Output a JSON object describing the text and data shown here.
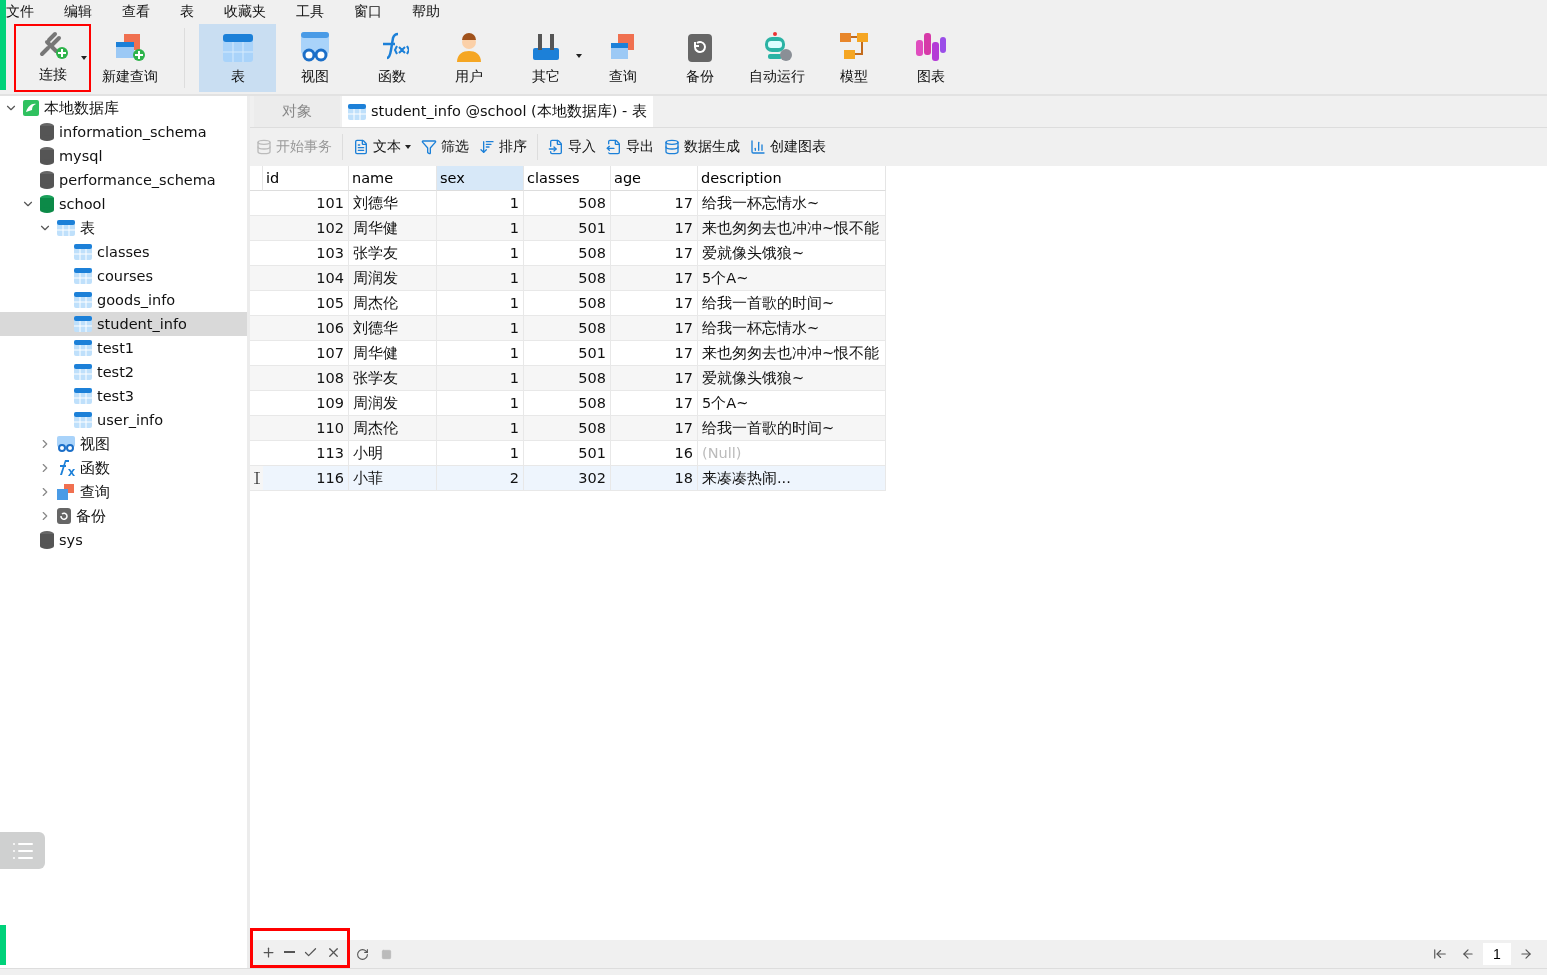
{
  "menu": [
    "文件",
    "编辑",
    "查看",
    "表",
    "收藏夹",
    "工具",
    "窗口",
    "帮助"
  ],
  "toolbar": [
    {
      "label": "连接",
      "selected": false,
      "dropdown": true,
      "highlighted": true
    },
    {
      "label": "新建查询",
      "selected": false,
      "dropdown": false,
      "highlighted": false
    },
    {
      "label": "表",
      "selected": true,
      "dropdown": false,
      "highlighted": false
    },
    {
      "label": "视图",
      "selected": false,
      "dropdown": false,
      "highlighted": false
    },
    {
      "label": "函数",
      "selected": false,
      "dropdown": false,
      "highlighted": false
    },
    {
      "label": "用户",
      "selected": false,
      "dropdown": false,
      "highlighted": false
    },
    {
      "label": "其它",
      "selected": false,
      "dropdown": true,
      "highlighted": false
    },
    {
      "label": "查询",
      "selected": false,
      "dropdown": false,
      "highlighted": false
    },
    {
      "label": "备份",
      "selected": false,
      "dropdown": false,
      "highlighted": false
    },
    {
      "label": "自动运行",
      "selected": false,
      "dropdown": false,
      "highlighted": false
    },
    {
      "label": "模型",
      "selected": false,
      "dropdown": false,
      "highlighted": false
    },
    {
      "label": "图表",
      "selected": false,
      "dropdown": false,
      "highlighted": false
    }
  ],
  "tree": [
    {
      "label": "本地数据库",
      "kind": "connection",
      "expanded": true,
      "selected": false,
      "children": [
        {
          "label": "information_schema",
          "kind": "database",
          "selected": false
        },
        {
          "label": "mysql",
          "kind": "database",
          "selected": false
        },
        {
          "label": "performance_schema",
          "kind": "database",
          "selected": false
        },
        {
          "label": "school",
          "kind": "database",
          "expanded": true,
          "selected": false,
          "children": [
            {
              "label": "表",
              "kind": "tables",
              "expanded": true,
              "selected": false,
              "children": [
                {
                  "label": "classes",
                  "kind": "table",
                  "selected": false
                },
                {
                  "label": "courses",
                  "kind": "table",
                  "selected": false
                },
                {
                  "label": "goods_info",
                  "kind": "table",
                  "selected": false
                },
                {
                  "label": "student_info",
                  "kind": "table",
                  "selected": true
                },
                {
                  "label": "test1",
                  "kind": "table",
                  "selected": false
                },
                {
                  "label": "test2",
                  "kind": "table",
                  "selected": false
                },
                {
                  "label": "test3",
                  "kind": "table",
                  "selected": false
                },
                {
                  "label": "user_info",
                  "kind": "table",
                  "selected": false
                }
              ]
            },
            {
              "label": "视图",
              "kind": "views",
              "expanded": false,
              "selected": false
            },
            {
              "label": "函数",
              "kind": "functions",
              "expanded": false,
              "selected": false
            },
            {
              "label": "查询",
              "kind": "queries",
              "expanded": false,
              "selected": false
            },
            {
              "label": "备份",
              "kind": "backups",
              "expanded": false,
              "selected": false
            }
          ]
        },
        {
          "label": "sys",
          "kind": "database",
          "selected": false
        }
      ]
    }
  ],
  "tabs": [
    {
      "label": "对象",
      "selected": false
    },
    {
      "label": "student_info @school (本地数据库) - 表",
      "selected": true
    }
  ],
  "actions": [
    {
      "label": "开始事务",
      "disabled": true
    },
    {
      "label": "文本",
      "disabled": false,
      "dropdown": true
    },
    {
      "label": "筛选",
      "disabled": false
    },
    {
      "label": "排序",
      "disabled": false
    },
    {
      "label": "导入",
      "disabled": false
    },
    {
      "label": "导出",
      "disabled": false
    },
    {
      "label": "数据生成",
      "disabled": false
    },
    {
      "label": "创建图表",
      "disabled": false
    }
  ],
  "table": {
    "columns": [
      {
        "label": "id",
        "selected": false
      },
      {
        "label": "name",
        "selected": false
      },
      {
        "label": "sex",
        "selected": true
      },
      {
        "label": "classes",
        "selected": false
      },
      {
        "label": "age",
        "selected": false
      },
      {
        "label": "description",
        "selected": false
      }
    ],
    "rows": [
      {
        "selected": false,
        "cells": [
          "101",
          "刘德华",
          "1",
          "508",
          "17",
          "给我一杯忘情水~"
        ]
      },
      {
        "selected": false,
        "cells": [
          "102",
          "周华健",
          "1",
          "501",
          "17",
          "来也匆匆去也冲冲~恨不能"
        ]
      },
      {
        "selected": false,
        "cells": [
          "103",
          "张学友",
          "1",
          "508",
          "17",
          "爱就像头饿狼~"
        ]
      },
      {
        "selected": false,
        "cells": [
          "104",
          "周润发",
          "1",
          "508",
          "17",
          "5个A~"
        ]
      },
      {
        "selected": false,
        "cells": [
          "105",
          "周杰伦",
          "1",
          "508",
          "17",
          "给我一首歌的时间~"
        ]
      },
      {
        "selected": false,
        "cells": [
          "106",
          "刘德华",
          "1",
          "508",
          "17",
          "给我一杯忘情水~"
        ]
      },
      {
        "selected": false,
        "cells": [
          "107",
          "周华健",
          "1",
          "501",
          "17",
          "来也匆匆去也冲冲~恨不能"
        ]
      },
      {
        "selected": false,
        "cells": [
          "108",
          "张学友",
          "1",
          "508",
          "17",
          "爱就像头饿狼~"
        ]
      },
      {
        "selected": false,
        "cells": [
          "109",
          "周润发",
          "1",
          "508",
          "17",
          "5个A~"
        ]
      },
      {
        "selected": false,
        "cells": [
          "110",
          "周杰伦",
          "1",
          "508",
          "17",
          "给我一首歌的时间~"
        ]
      },
      {
        "selected": false,
        "cells": [
          "113",
          "小明",
          "1",
          "501",
          "16",
          {
            "text": "(Null)",
            "null": true
          }
        ]
      },
      {
        "selected": true,
        "cells": [
          "116",
          "小菲",
          "2",
          "302",
          "18",
          "来凑凑热闹..."
        ]
      }
    ]
  },
  "footer": {
    "highlighted": true,
    "page": "1"
  }
}
